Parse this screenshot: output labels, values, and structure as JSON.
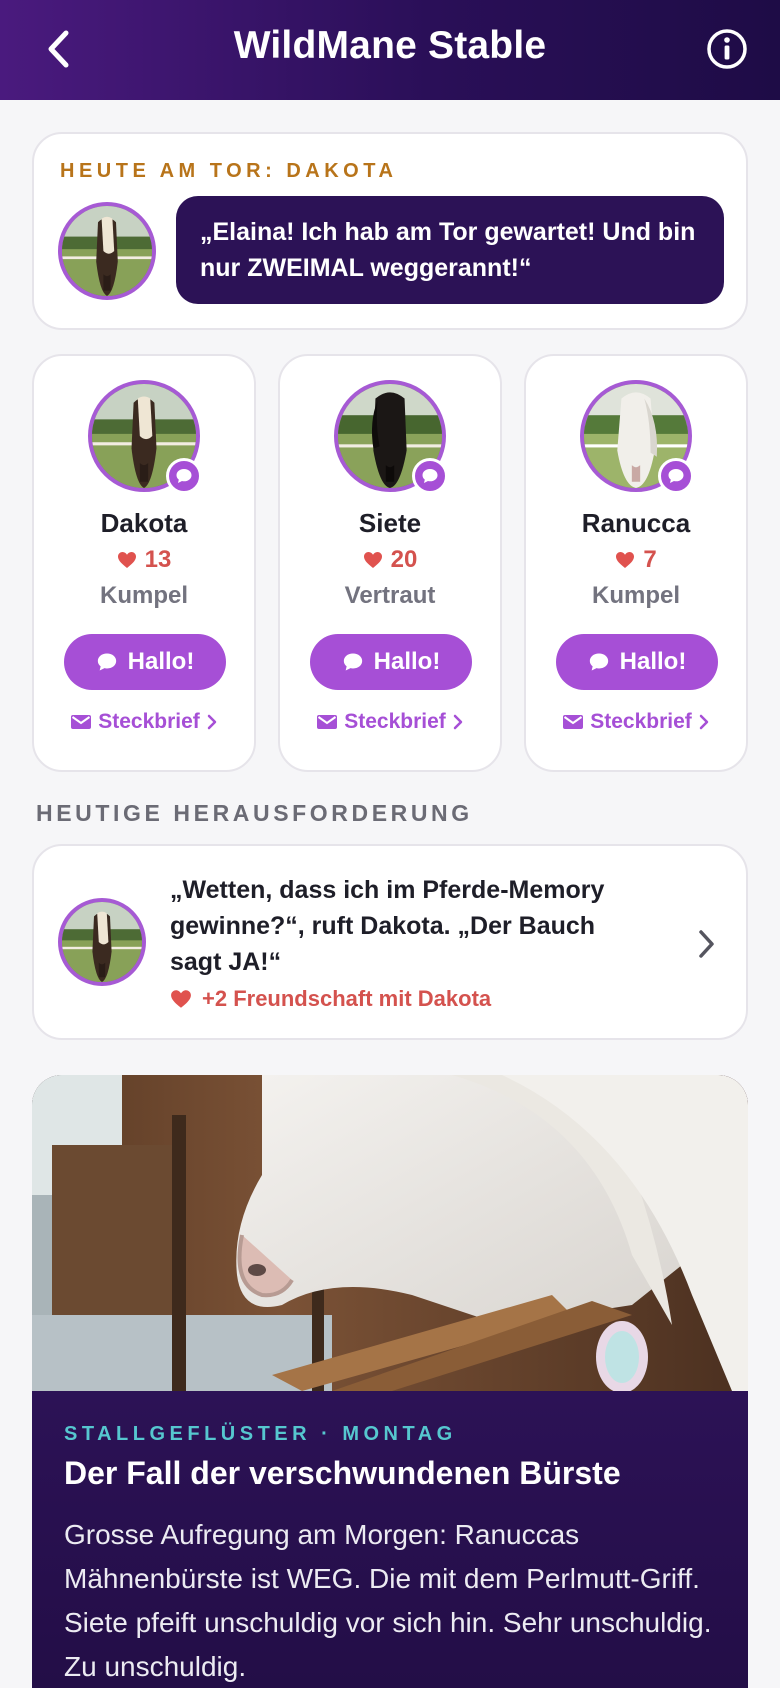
{
  "header": {
    "title": "WildMane Stable"
  },
  "gate": {
    "label": "HEUTE AM TOR: DAKOTA",
    "quote": "„Elaina! Ich hab am Tor gewartet! Und bin nur ZWEIMAL weggerannt!“"
  },
  "friends": [
    {
      "name": "Dakota",
      "hearts": "13",
      "rank": "Kumpel",
      "hello_label": "Hallo!",
      "profile_label": "Steckbrief"
    },
    {
      "name": "Siete",
      "hearts": "20",
      "rank": "Vertraut",
      "hello_label": "Hallo!",
      "profile_label": "Steckbrief"
    },
    {
      "name": "Ranucca",
      "hearts": "7",
      "rank": "Kumpel",
      "hello_label": "Hallo!",
      "profile_label": "Steckbrief"
    }
  ],
  "challenge": {
    "section_label": "HEUTIGE HERAUSFORDERUNG",
    "text": "„Wetten, dass ich im Pferde-Memory gewinne?“, ruft Dakota. „Der Bauch sagt JA!“",
    "reward": "+2 Freundschaft mit Dakota"
  },
  "story": {
    "meta": "STALLGEFLÜSTER · MONTAG",
    "headline": "Der Fall der verschwundenen Bürste",
    "body": "Grosse Aufregung am Morgen: Ranuccas Mähnenbürste ist WEG. Die mit dem Perlmutt-Griff. Siete pfeift unschuldig vor sich hin. Sehr unschuldig. Zu unschuldig."
  },
  "colors": {
    "accent": "#a64fd6",
    "header_dark": "#2a0f58",
    "heart": "#d4524e",
    "gate_label": "#b8741a",
    "story_meta": "#56c7cf"
  },
  "icons": {
    "back": "chevron-left-icon",
    "info": "info-icon",
    "chat": "chat-bubble-icon",
    "heart": "heart-icon",
    "mail": "mail-icon",
    "chevron": "chevron-right-icon"
  }
}
